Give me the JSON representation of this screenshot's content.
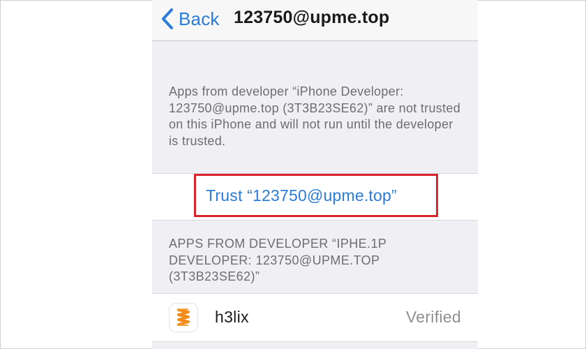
{
  "navbar": {
    "back_label": "Back",
    "title": "123750@upme.top"
  },
  "description": {
    "text": "Apps from developer “iPhone Developer: 123750@upme.top (3T3B23SE62)” are not trusted on this iPhone and will not run until the developer is trusted."
  },
  "trust": {
    "label": "Trust “123750@upme.top”"
  },
  "apps_section": {
    "header": "APPS FROM DEVELOPER “IPHE.1P DEVELOPER: 123750@UPME.TOP (3T3B23SE62)”"
  },
  "apps": [
    {
      "name": "h3lix",
      "status": "Verified",
      "icon": "spring-icon"
    }
  ],
  "colors": {
    "accent_blue": "#2b7bd8",
    "highlight_red": "#d9232d",
    "background": "#efeff4",
    "secondary_text": "#6d6d72",
    "icon_orange": "#f28c1b"
  }
}
